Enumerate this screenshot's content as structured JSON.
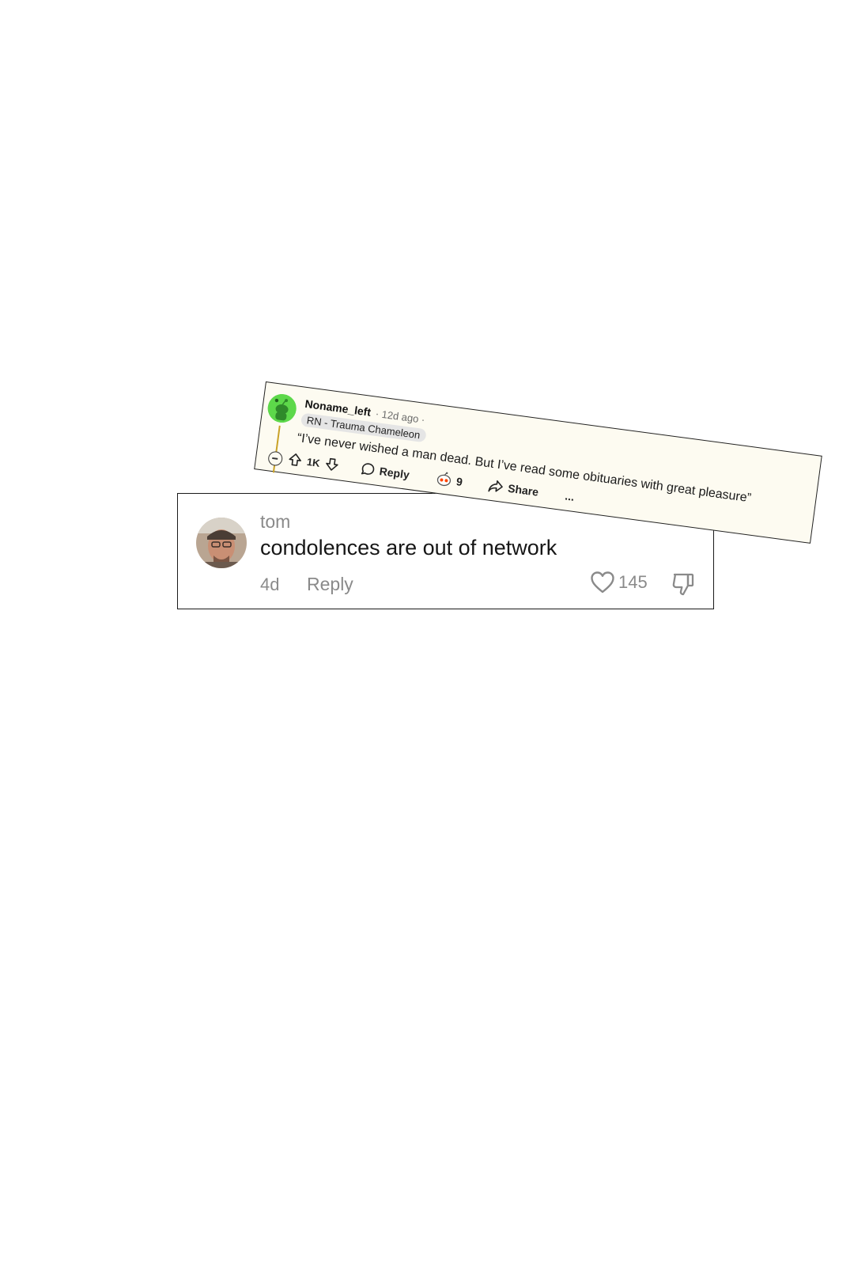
{
  "tiktok_comment": {
    "username": "tom",
    "text": "condolences are out of network",
    "age": "4d",
    "reply_label": "Reply",
    "like_count": "145",
    "icons": [
      "avatar-photo",
      "heart-icon",
      "thumbs-down-icon"
    ]
  },
  "reddit_comment": {
    "username": "Noname_left",
    "meta": "· 12d ago ·",
    "flair": "RN - Trauma Chameleon",
    "body": "“I’ve never wished a man dead. But I’ve read some obituaries with great pleasure”",
    "vote_count": "1K",
    "reply_label": "Reply",
    "award_count": "9",
    "share_label": "Share",
    "more_label": "...",
    "colors": {
      "avatar_bg": "#5dd84a",
      "card_bg": "#fdfbf1",
      "thread_line": "#c9a227"
    },
    "icons": [
      "snoo-avatar-icon",
      "collapse-icon",
      "upvote-icon",
      "downvote-icon",
      "comment-icon",
      "award-icon",
      "share-icon"
    ]
  }
}
